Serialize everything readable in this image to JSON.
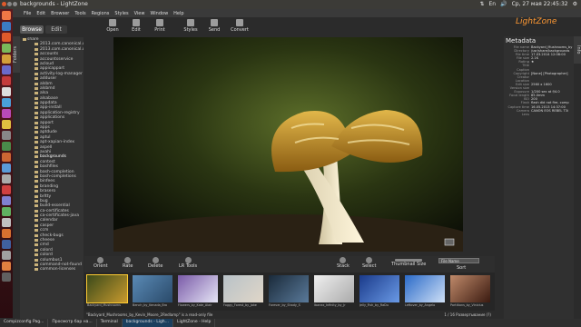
{
  "window": {
    "title": "backgrounds - LightZone"
  },
  "status_bar": {
    "items": [
      "⇅",
      "En",
      "🔊",
      "Ср, 27 мая 22:45:32",
      "⚙"
    ]
  },
  "menu": [
    "File",
    "Edit",
    "Browser",
    "Tools",
    "Regions",
    "Styles",
    "View",
    "Window",
    "Help"
  ],
  "modes": {
    "browse": "Browse",
    "edit": "Edit"
  },
  "toolbar": {
    "open": "Open",
    "edit": "Edit",
    "print": "Print",
    "styles": "Styles",
    "send": "Send",
    "convert": "Convert"
  },
  "logo": "LightZone",
  "side_tabs": {
    "folders": "Folders",
    "info": "Info"
  },
  "tree": [
    {
      "label": "share",
      "level": 1
    },
    {
      "label": "2013.com.canonical.u"
    },
    {
      "label": "2013.com.canonical.u"
    },
    {
      "label": "accounts"
    },
    {
      "label": "accountsservice"
    },
    {
      "label": "acloud"
    },
    {
      "label": "appicappart"
    },
    {
      "label": "activity-log-manager"
    },
    {
      "label": "adduser"
    },
    {
      "label": "alsbm"
    },
    {
      "label": "alsbmd"
    },
    {
      "label": "alsa"
    },
    {
      "label": "alsabase"
    },
    {
      "label": "appdata"
    },
    {
      "label": "app-install"
    },
    {
      "label": "application-registry"
    },
    {
      "label": "applications"
    },
    {
      "label": "apport"
    },
    {
      "label": "apps"
    },
    {
      "label": "aptdude"
    },
    {
      "label": "aptul"
    },
    {
      "label": "apt-xapian-index"
    },
    {
      "label": "aspell"
    },
    {
      "label": "avahi"
    },
    {
      "label": "backgrounds",
      "selected": true
    },
    {
      "label": "contest"
    },
    {
      "label": "bashfiles"
    },
    {
      "label": "bash-completion"
    },
    {
      "label": "bash-completions"
    },
    {
      "label": "binfees"
    },
    {
      "label": "branding"
    },
    {
      "label": "brasero"
    },
    {
      "label": "brltty"
    },
    {
      "label": "bug"
    },
    {
      "label": "build-essential"
    },
    {
      "label": "ca-certificates"
    },
    {
      "label": "ca-certificates-java"
    },
    {
      "label": "calendar"
    },
    {
      "label": "casper"
    },
    {
      "label": "ccm"
    },
    {
      "label": "check-bugs"
    },
    {
      "label": "cheese"
    },
    {
      "label": "cmd"
    },
    {
      "label": "colord"
    },
    {
      "label": "colord"
    },
    {
      "label": "columbus1"
    },
    {
      "label": "command-not-found"
    },
    {
      "label": "common-licenses"
    }
  ],
  "metadata": {
    "title": "Metadata",
    "rows": [
      {
        "k": "File name",
        "v": "Backyard_Mushrooms_by"
      },
      {
        "k": "Directory",
        "v": "/usr/share/backgrounds"
      },
      {
        "k": "File time",
        "v": "17.03.2014 12:08:00"
      },
      {
        "k": "File size",
        "v": "2.1K"
      },
      {
        "k": "",
        "v": ""
      },
      {
        "k": "Rating",
        "v": "★"
      },
      {
        "k": "Title",
        "v": ""
      },
      {
        "k": "Caption",
        "v": ""
      },
      {
        "k": "Copyright",
        "v": "[None] [Photographer]"
      },
      {
        "k": "Creator",
        "v": ""
      },
      {
        "k": "Location",
        "v": ""
      },
      {
        "k": "",
        "v": ""
      },
      {
        "k": "Edit size",
        "v": "2560 x 1600"
      },
      {
        "k": "Version size",
        "v": ""
      },
      {
        "k": "Exposure",
        "v": "1/200 sec at f/4.0"
      },
      {
        "k": "Focal length",
        "v": "85.0mm"
      },
      {
        "k": "ISO",
        "v": "200"
      },
      {
        "k": "Flash",
        "v": "flash did not fire, comp"
      },
      {
        "k": "Capture time",
        "v": "16.05.2013 14:37:00"
      },
      {
        "k": "Camera",
        "v": "CANON EOS REBEL T3i"
      },
      {
        "k": "Lens",
        "v": ""
      }
    ]
  },
  "bottom_toolbar": {
    "orient": "Orient",
    "rate": "Rate",
    "delete": "Delete",
    "lr_tools": "LR Tools",
    "stack": "Stack",
    "select": "Select",
    "thumb_size": "Thumbnail Size",
    "sort": "Sort",
    "sort_value": "File Name"
  },
  "thumbs": [
    {
      "caption": "Backyard_Mushrooms",
      "selected": true,
      "colors": [
        "#3a4a1a",
        "#c99a2e"
      ]
    },
    {
      "caption": "Bench_by_Kenada_Bro",
      "colors": [
        "#5a8ab5",
        "#2a4a6a"
      ]
    },
    {
      "caption": "Flowers_by_Kate_Alair",
      "colors": [
        "#7a5aa8",
        "#e6e6f6"
      ]
    },
    {
      "caption": "Foggy_Forest_by_Jake",
      "colors": [
        "#b8c2c8",
        "#e0d6c8"
      ]
    },
    {
      "caption": "Forever_by_Shady_S",
      "colors": [
        "#1a2a3a",
        "#5a7a9a"
      ]
    },
    {
      "caption": "Ibanez_Infinity_by_Jr",
      "colors": [
        "#f0f0f0",
        "#aaaaaa"
      ]
    },
    {
      "caption": "Jelly_Fish_by_RaDu",
      "colors": [
        "#1a3a8a",
        "#6a9ae6"
      ]
    },
    {
      "caption": "Leftover_by_Angelo",
      "colors": [
        "#2a6ac8",
        "#cfe0f6"
      ]
    },
    {
      "caption": "Partitions_by_Vinicius",
      "colors": [
        "#c08a6a",
        "#3a1a10"
      ]
    }
  ],
  "status_text": "1 / 16 Развертывание (?)",
  "status_path": "Backyard_Mushrooms_by_Kevin_Moore_2Redlamp - Is a read-only file",
  "status_left": "\"Backyard_Mushrooms_by_Kevin_Moore_2Redlamp\" is a read-only file",
  "taskbar": [
    {
      "label": "Compizconfig Pag..."
    },
    {
      "label": "Просмотр бар на..."
    },
    {
      "label": "Terminal"
    },
    {
      "label": "backgrounds - Ligh...",
      "active": true
    },
    {
      "label": "LightZone - Help"
    }
  ],
  "colors": {
    "accent": "#ff9933",
    "selection": "#ffcc33"
  }
}
